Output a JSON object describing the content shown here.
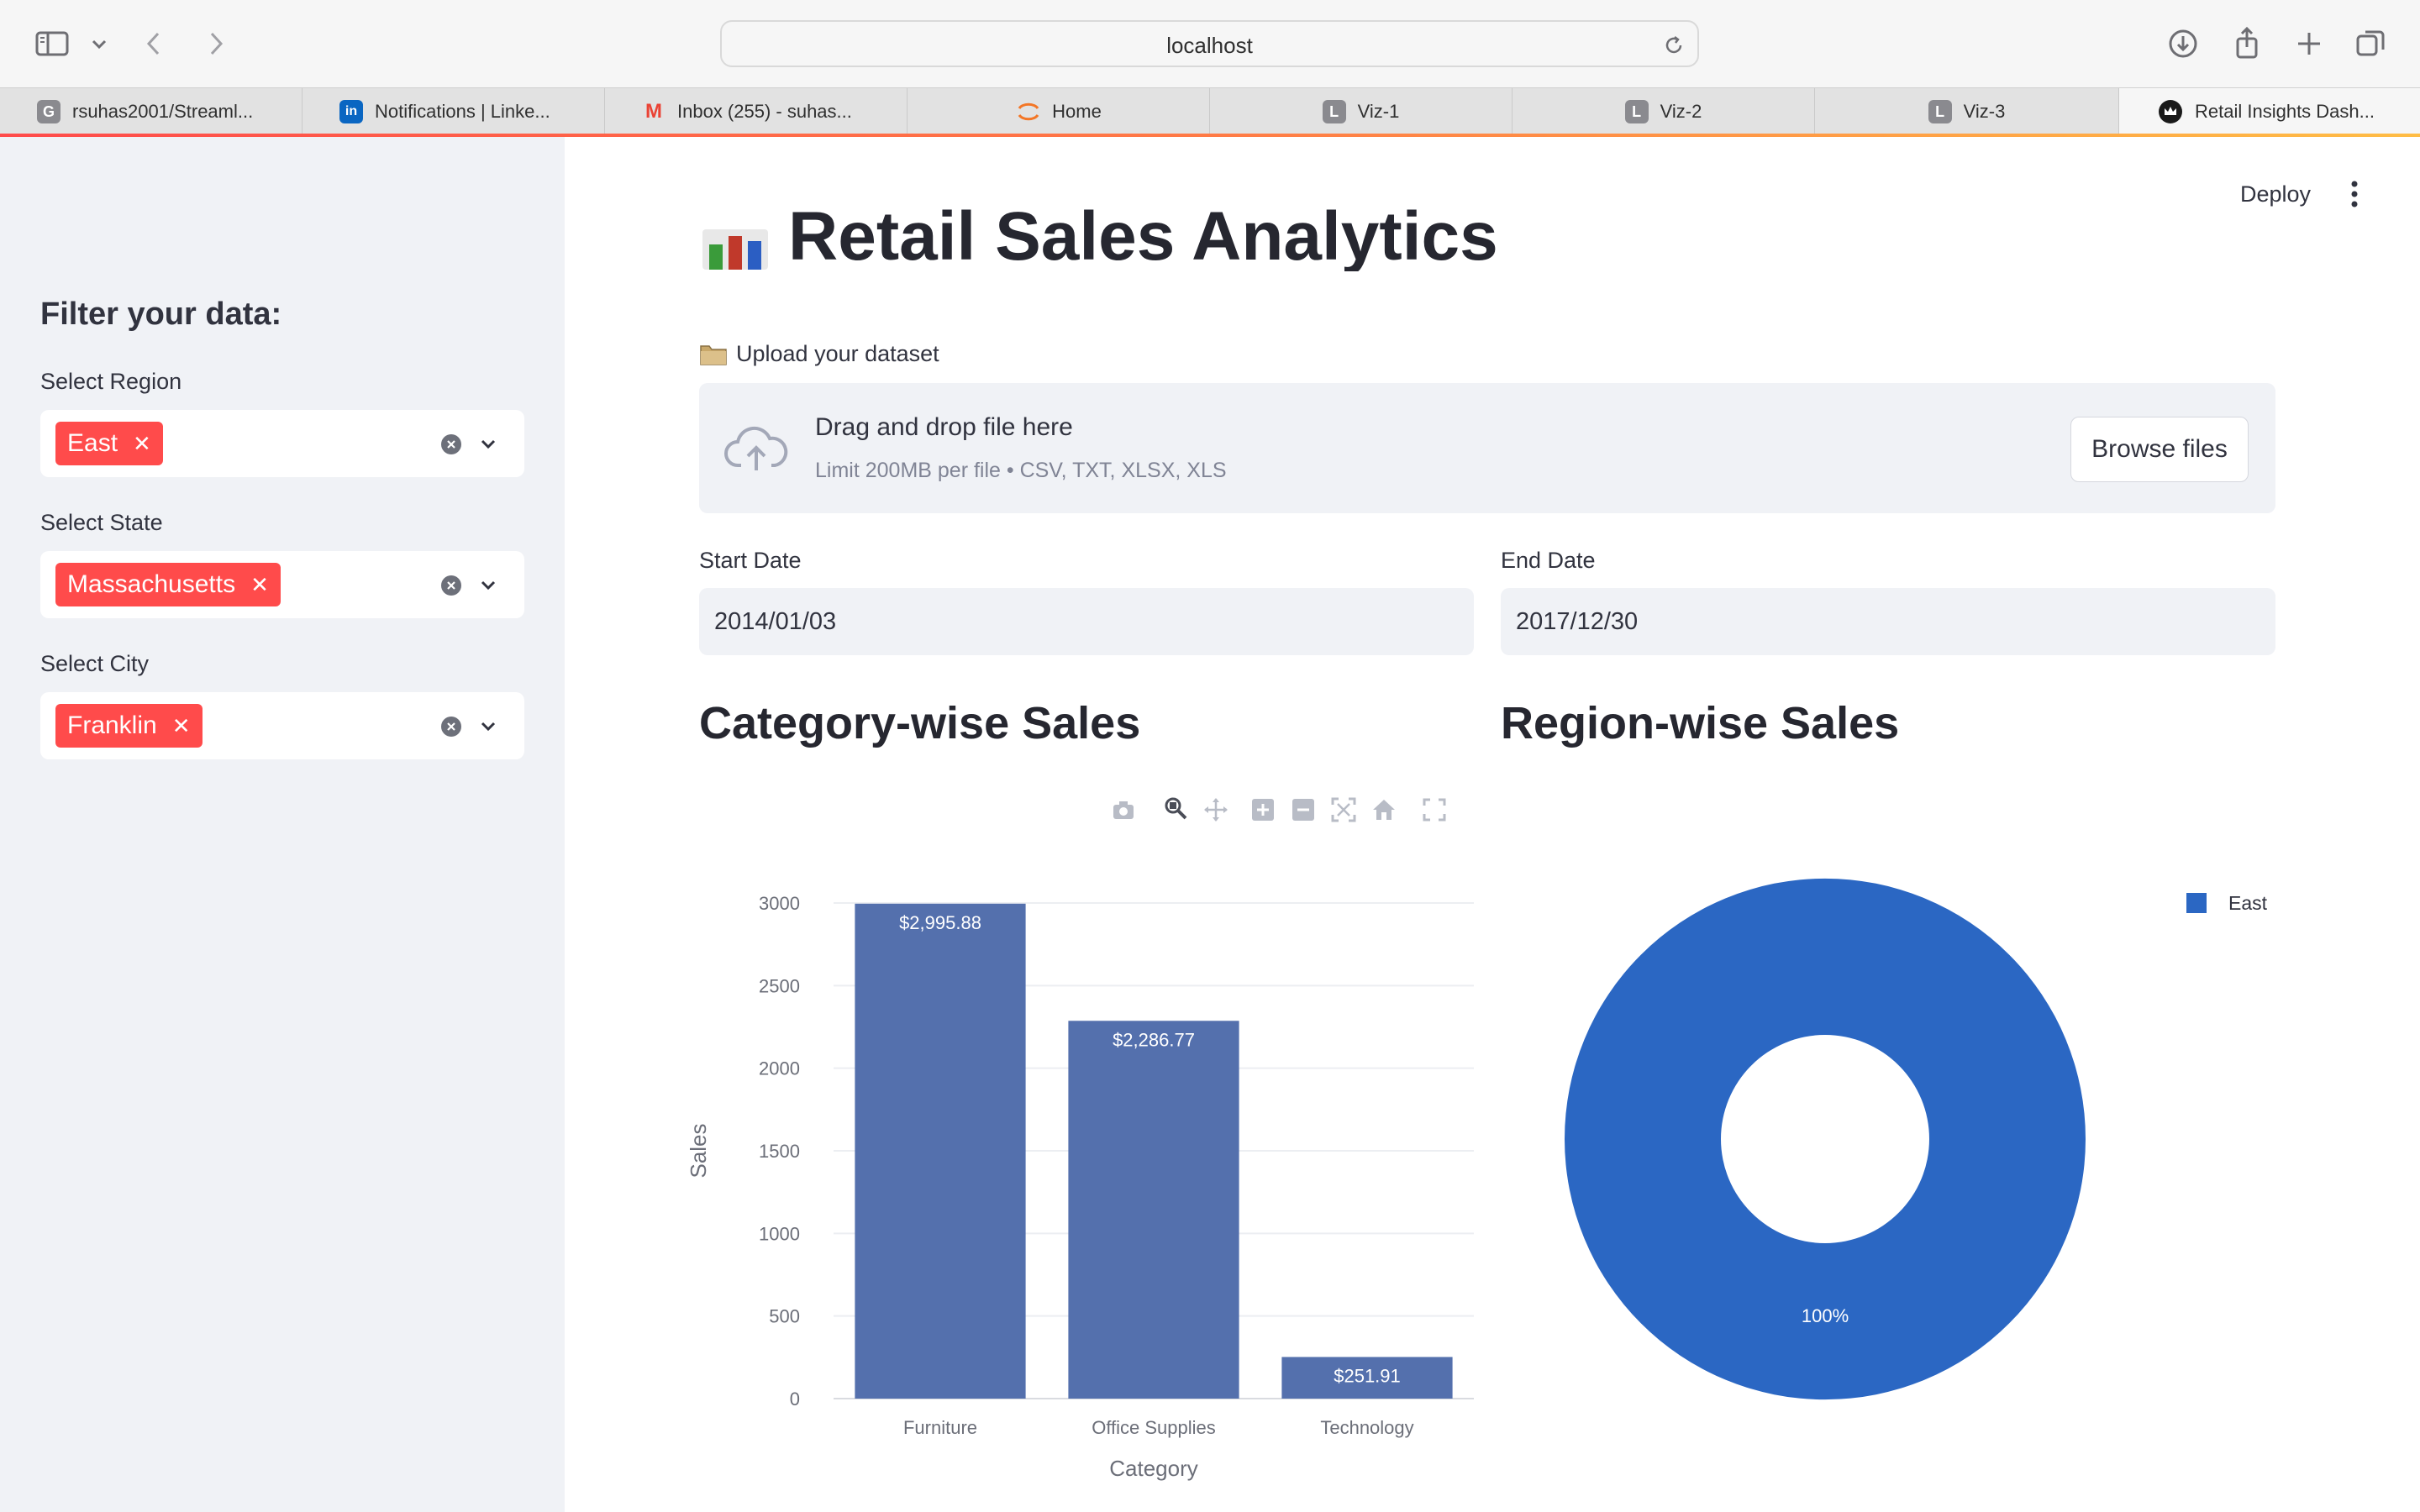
{
  "browser": {
    "address": "localhost",
    "tabs": [
      {
        "title": "rsuhas2001/Streaml...",
        "favicon_text": "G",
        "favicon_color": "#8a8a8f"
      },
      {
        "title": "Notifications | Linke...",
        "favicon_text": "in",
        "favicon_color": "#0a66c2"
      },
      {
        "title": "Inbox (255) - suhas...",
        "favicon_text": "M",
        "favicon_color": "#ea4335"
      },
      {
        "title": "Home",
        "favicon_text": "",
        "favicon_color": "#f37626"
      },
      {
        "title": "Viz-1",
        "favicon_text": "L",
        "favicon_color": "#8a8a8f"
      },
      {
        "title": "Viz-2",
        "favicon_text": "L",
        "favicon_color": "#8a8a8f"
      },
      {
        "title": "Viz-3",
        "favicon_text": "L",
        "favicon_color": "#8a8a8f"
      },
      {
        "title": "Retail Insights Dash...",
        "favicon_text": "",
        "favicon_color": "#1a1a1a",
        "active": true
      }
    ]
  },
  "sidebar": {
    "title": "Filter your data:",
    "filters": [
      {
        "label": "Select Region",
        "selected": "East"
      },
      {
        "label": "Select State",
        "selected": "Massachusetts"
      },
      {
        "label": "Select City",
        "selected": "Franklin"
      }
    ]
  },
  "header": {
    "deploy_label": "Deploy"
  },
  "page": {
    "title": "Retail Sales Analytics",
    "upload_label": "Upload your dataset",
    "dropzone": {
      "main_text": "Drag and drop file here",
      "limit_text": "Limit 200MB per file • CSV, TXT, XLSX, XLS",
      "browse_label": "Browse files"
    },
    "start_date": {
      "label": "Start Date",
      "value": "2014/01/03"
    },
    "end_date": {
      "label": "End Date",
      "value": "2017/12/30"
    },
    "category_title": "Category-wise Sales",
    "region_title": "Region-wise Sales"
  },
  "colors": {
    "accent": "#ff4b4b",
    "bar": "#5470ad",
    "pie": "#2b67c3",
    "sidebar_bg": "#f0f2f6"
  },
  "chart_data": [
    {
      "type": "bar",
      "categories": [
        "Furniture",
        "Office Supplies",
        "Technology"
      ],
      "values": [
        2995.88,
        2286.77,
        251.91
      ],
      "data_labels": [
        "$2,995.88",
        "$2,286.77",
        "$251.91"
      ],
      "xlabel": "Category",
      "ylabel": "Sales",
      "ylim": [
        0,
        3000
      ],
      "yticks": [
        0,
        500,
        1000,
        1500,
        2000,
        2500,
        3000
      ],
      "grid": true
    },
    {
      "type": "pie",
      "labels": [
        "East"
      ],
      "values": [
        100
      ],
      "data_labels": [
        "100%"
      ],
      "hole": true,
      "legend": "top-right"
    }
  ]
}
